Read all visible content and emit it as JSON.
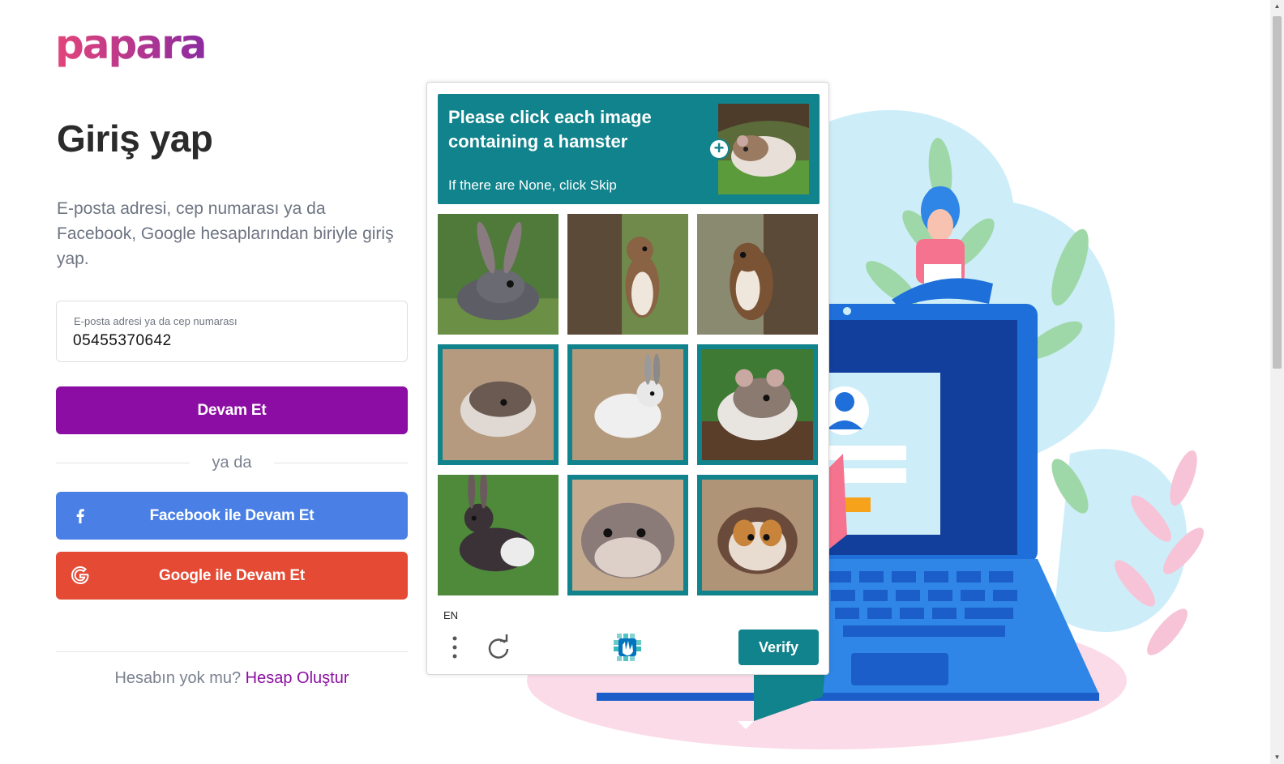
{
  "brand": {
    "name": "papara"
  },
  "login": {
    "title": "Giriş yap",
    "subtitle": "E-posta adresi, cep numarası ya da Facebook, Google hesaplarından biriyle giriş yap.",
    "field_label": "E-posta adresi ya da cep numarası",
    "field_value": "05455370642",
    "continue_label": "Devam Et",
    "or_label": "ya da",
    "facebook_label": "Facebook ile Devam Et",
    "google_label": "Google ile Devam Et",
    "signup_prompt": "Hesabın yok mu?",
    "signup_link": "Hesap Oluştur"
  },
  "captcha": {
    "prompt": "Please click each image containing a hamster",
    "hint": "If there are None, click Skip",
    "language": "EN",
    "verify_label": "Verify",
    "tiles": [
      {
        "subject": "rabbit",
        "selected": false
      },
      {
        "subject": "squirrel",
        "selected": false
      },
      {
        "subject": "squirrel",
        "selected": false
      },
      {
        "subject": "hamster",
        "selected": true
      },
      {
        "subject": "rabbit",
        "selected": true
      },
      {
        "subject": "hamster",
        "selected": true
      },
      {
        "subject": "rabbit",
        "selected": false
      },
      {
        "subject": "hamster",
        "selected": true
      },
      {
        "subject": "hamster",
        "selected": true
      }
    ]
  },
  "colors": {
    "brand_purple": "#8c0da3",
    "facebook_blue": "#4a80e6",
    "google_red": "#e44a34",
    "captcha_teal": "#11838c"
  },
  "icons": [
    "facebook-icon",
    "google-icon",
    "plus-icon",
    "menu-dots-icon",
    "refresh-icon",
    "hcaptcha-logo-icon"
  ]
}
